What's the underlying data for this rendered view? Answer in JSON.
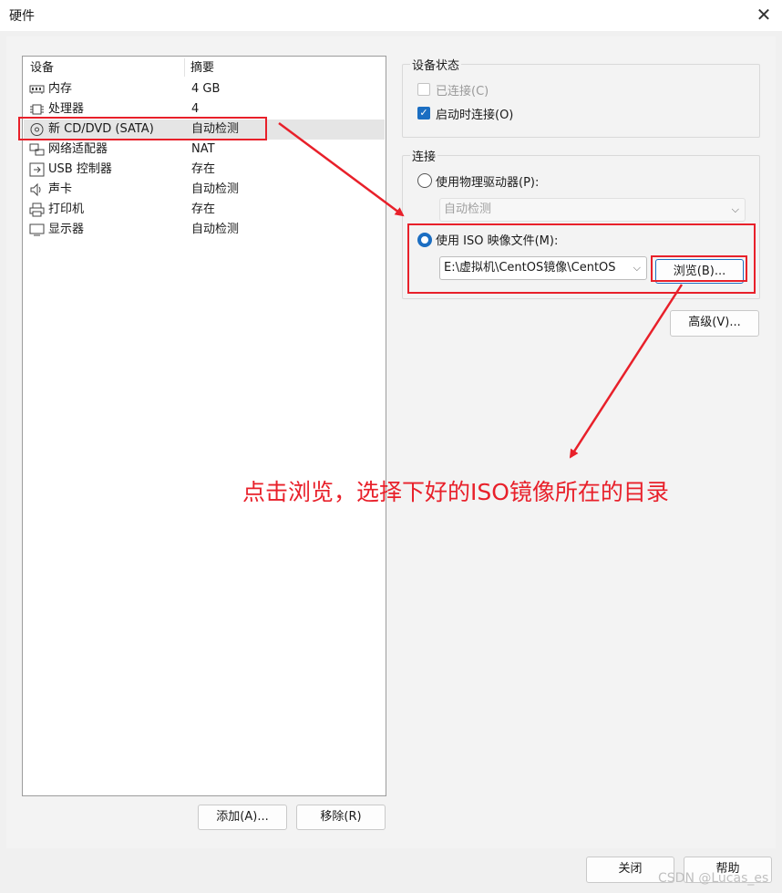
{
  "window": {
    "title": "硬件",
    "close_glyph": "✕"
  },
  "device_list": {
    "col_device": "设备",
    "col_summary": "摘要",
    "rows": [
      {
        "icon": "memory-icon",
        "name": "内存",
        "summary": "4 GB",
        "selected": false
      },
      {
        "icon": "processor-icon",
        "name": "处理器",
        "summary": "4",
        "selected": false
      },
      {
        "icon": "cd-dvd-icon",
        "name": "新 CD/DVD (SATA)",
        "summary": "自动检测",
        "selected": true
      },
      {
        "icon": "network-adapter-icon",
        "name": "网络适配器",
        "summary": "NAT",
        "selected": false
      },
      {
        "icon": "usb-icon",
        "name": "USB 控制器",
        "summary": "存在",
        "selected": false
      },
      {
        "icon": "sound-card-icon",
        "name": "声卡",
        "summary": "自动检测",
        "selected": false
      },
      {
        "icon": "printer-icon",
        "name": "打印机",
        "summary": "存在",
        "selected": false
      },
      {
        "icon": "display-icon",
        "name": "显示器",
        "summary": "自动检测",
        "selected": false
      }
    ]
  },
  "list_buttons": {
    "add": "添加(A)...",
    "remove": "移除(R)"
  },
  "device_status": {
    "label": "设备状态",
    "connected": {
      "label": "已连接(C)",
      "checked": false,
      "enabled": false
    },
    "connect_at_power_on": {
      "label": "启动时连接(O)",
      "checked": true
    }
  },
  "connection": {
    "label": "连接",
    "physical": {
      "label": "使用物理驱动器(P):",
      "selected": false
    },
    "physical_value": "自动检测",
    "iso": {
      "label": "使用 ISO 映像文件(M):",
      "selected": true
    },
    "iso_path": "E:\\虚拟机\\CentOS镜像\\CentOS",
    "browse": "浏览(B)..."
  },
  "advanced": "高级(V)...",
  "footer": {
    "close": "关闭",
    "help": "帮助"
  },
  "annotation": {
    "text": "点击浏览，选择下好的ISO镜像所在的目录",
    "color": "#e8202a"
  },
  "watermark": "CSDN @Lucas_es",
  "colors": {
    "accent": "#1b6ec2",
    "highlight": "#e8202a"
  }
}
